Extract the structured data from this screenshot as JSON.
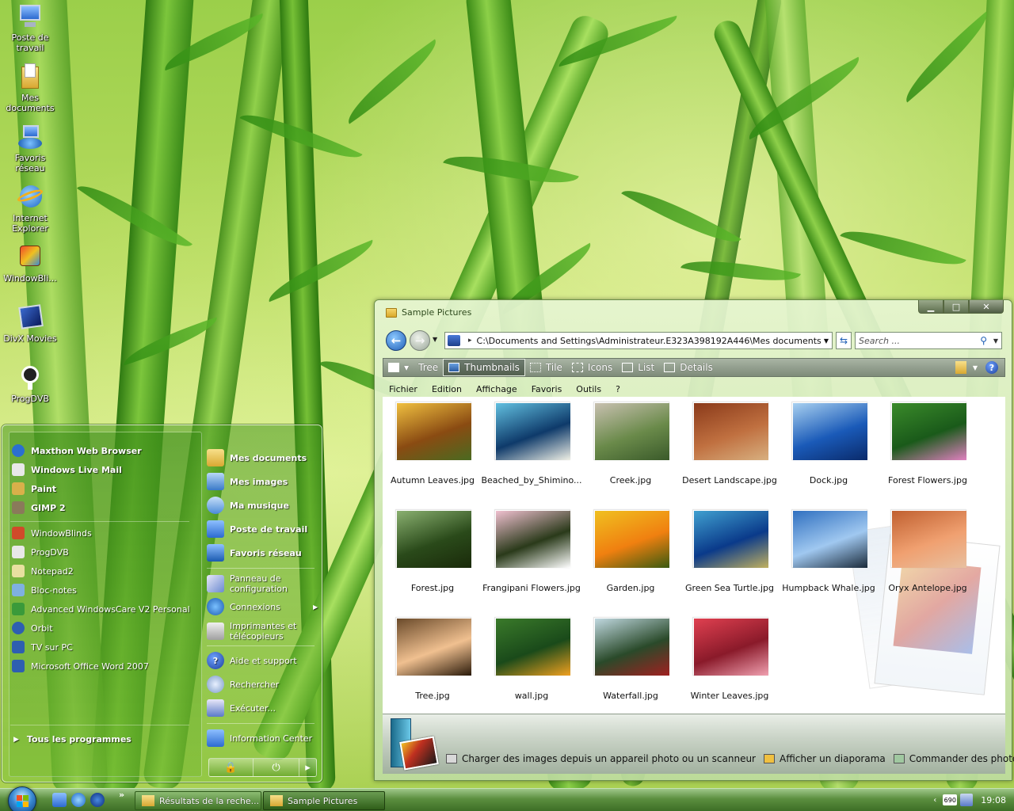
{
  "desktop": {
    "icons": [
      {
        "label": "Poste de travail",
        "icon": "computer-icon"
      },
      {
        "label": "Mes documents",
        "icon": "documents-folder-icon"
      },
      {
        "label": "Favoris réseau",
        "icon": "network-icon"
      },
      {
        "label": "Internet Explorer",
        "icon": "ie-icon"
      },
      {
        "label": "WindowBli...",
        "icon": "windowblinds-icon"
      },
      {
        "label": "DivX Movies",
        "icon": "divx-icon"
      },
      {
        "label": "ProgDVB",
        "icon": "satellite-icon"
      }
    ]
  },
  "start_menu": {
    "pinned": [
      {
        "label": "Maxthon Web Browser",
        "color": "#2b6fd0"
      },
      {
        "label": "Windows Live Mail",
        "color": "#e8e8e8"
      },
      {
        "label": "Paint",
        "color": "#d9b04a"
      },
      {
        "label": "GIMP 2",
        "color": "#8a7a5a"
      }
    ],
    "recent": [
      {
        "label": "WindowBlinds",
        "color": "#d04a2a"
      },
      {
        "label": "ProgDVB",
        "color": "#e8e8e8"
      },
      {
        "label": "Notepad2",
        "color": "#e8e0a0"
      },
      {
        "label": "Bloc-notes",
        "color": "#7fb0e0"
      },
      {
        "label": "Advanced WindowsCare V2 Personal",
        "color": "#3a9a3a"
      },
      {
        "label": "Orbit",
        "color": "#2e5fb0"
      },
      {
        "label": "TV sur PC",
        "color": "#2e5fb0"
      },
      {
        "label": "Microsoft Office Word 2007",
        "color": "#2e5fb0"
      }
    ],
    "all_programs": "Tous les programmes",
    "right": [
      {
        "label": "Mes documents",
        "bold": true
      },
      {
        "label": "Mes images",
        "bold": true
      },
      {
        "label": "Ma musique",
        "bold": true
      },
      {
        "label": "Poste de travail",
        "bold": true
      },
      {
        "label": "Favoris réseau",
        "bold": true
      },
      {
        "label": "Panneau de configuration",
        "bold": false
      },
      {
        "label": "Connexions",
        "bold": false
      },
      {
        "label": "Imprimantes et télécopieurs",
        "bold": false
      },
      {
        "label": "Aide et support",
        "bold": false
      },
      {
        "label": "Rechercher",
        "bold": false
      },
      {
        "label": "Exécuter...",
        "bold": false
      },
      {
        "label": "Information Center",
        "bold": false
      }
    ],
    "power": {
      "lock": "🔒",
      "shutdown": "⏻",
      "arrow": "▸"
    }
  },
  "explorer": {
    "title": "Sample Pictures",
    "window_buttons": {
      "min": "▁",
      "max": "□",
      "close": "✕"
    },
    "address": "C:\\Documents and Settings\\Administrateur.E323A398192A446\\Mes documents\\Mes i",
    "search_placeholder": "Search ...",
    "toolbar": {
      "tree": "Tree",
      "thumbnails": "Thumbnails",
      "tile": "Tile",
      "icons": "Icons",
      "list": "List",
      "details": "Details"
    },
    "menu": [
      "Fichier",
      "Edition",
      "Affichage",
      "Favoris",
      "Outils",
      "?"
    ],
    "files": [
      {
        "name": "Autumn Leaves.jpg",
        "c1": "#8a4b12",
        "c2": "#f0c040",
        "c3": "#4a6a20"
      },
      {
        "name": "Beached_by_Shimino...",
        "c1": "#0e3a6a",
        "c2": "#62c0e0",
        "c3": "#f0f0e6"
      },
      {
        "name": "Creek.jpg",
        "c1": "#6a8a4a",
        "c2": "#c8c0b0",
        "c3": "#3a5a2a"
      },
      {
        "name": "Desert Landscape.jpg",
        "c1": "#c07040",
        "c2": "#8a3a1a",
        "c3": "#d8b080"
      },
      {
        "name": "Dock.jpg",
        "c1": "#1a5ab8",
        "c2": "#a8d0f0",
        "c3": "#0a2a6a"
      },
      {
        "name": "Forest Flowers.jpg",
        "c1": "#1a5a1a",
        "c2": "#3a8a2a",
        "c3": "#e080c0"
      },
      {
        "name": "Forest.jpg",
        "c1": "#2a4a1a",
        "c2": "#8ab070",
        "c3": "#1a2a0a"
      },
      {
        "name": "Frangipani Flowers.jpg",
        "c1": "#2a3a1a",
        "c2": "#f0c0d0",
        "c3": "#ffffff"
      },
      {
        "name": "Garden.jpg",
        "c1": "#f08010",
        "c2": "#f0c020",
        "c3": "#3a5a10"
      },
      {
        "name": "Green Sea Turtle.jpg",
        "c1": "#0a3a8a",
        "c2": "#40a0d0",
        "c3": "#c0b060"
      },
      {
        "name": "Humpback Whale.jpg",
        "c1": "#a0c8f0",
        "c2": "#3070c0",
        "c3": "#1a2a3a"
      },
      {
        "name": "Oryx Antelope.jpg",
        "c1": "#f0a070",
        "c2": "#c06030",
        "c3": "#e8c0a0"
      },
      {
        "name": "Tree.jpg",
        "c1": "#f0c090",
        "c2": "#6a4a2a",
        "c3": "#2a1a0a"
      },
      {
        "name": "wall.jpg",
        "c1": "#1a4a1a",
        "c2": "#3a7a2a",
        "c3": "#f0a020"
      },
      {
        "name": "Waterfall.jpg",
        "c1": "#2a4a2a",
        "c2": "#c0d8e0",
        "c3": "#a02020"
      },
      {
        "name": "Winter Leaves.jpg",
        "c1": "#8a1a2a",
        "c2": "#e04050",
        "c3": "#f0a0b0"
      }
    ],
    "tasks": [
      {
        "label": "Charger des images depuis un appareil photo ou un scanneur",
        "icon": "camera-icon"
      },
      {
        "label": "Afficher un diaporama",
        "icon": "slideshow-icon"
      },
      {
        "label": "Commander des photos via",
        "icon": "order-prints-icon"
      }
    ]
  },
  "taskbar": {
    "quicklaunch_more": "»",
    "tasks": [
      {
        "label": "Résultats de la reche...",
        "active": false
      },
      {
        "label": "Sample Pictures",
        "active": true
      }
    ],
    "tray": {
      "chevron": "‹",
      "tv_label": "690",
      "clock": "19:08"
    }
  }
}
